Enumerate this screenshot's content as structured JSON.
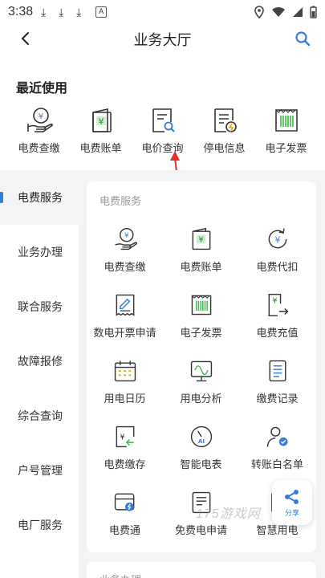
{
  "status_bar": {
    "time": "3:38"
  },
  "header": {
    "title": "业务大厅"
  },
  "recent": {
    "title": "最近使用",
    "items": [
      {
        "label": "电费查缴",
        "icon": "bill-pay-icon"
      },
      {
        "label": "电费账单",
        "icon": "wallet-icon"
      },
      {
        "label": "电价查询",
        "icon": "price-query-icon"
      },
      {
        "label": "停电信息",
        "icon": "outage-info-icon"
      },
      {
        "label": "电子发票",
        "icon": "e-invoice-icon"
      }
    ]
  },
  "sidebar": {
    "items": [
      {
        "label": "电费服务",
        "active": true
      },
      {
        "label": "业务办理"
      },
      {
        "label": "联合服务"
      },
      {
        "label": "故障报修"
      },
      {
        "label": "综合查询"
      },
      {
        "label": "户号管理"
      },
      {
        "label": "电厂服务"
      }
    ]
  },
  "section": {
    "title": "电费服务",
    "items": [
      {
        "label": "电费查缴",
        "icon": "bill-pay-icon"
      },
      {
        "label": "电费账单",
        "icon": "wallet-icon"
      },
      {
        "label": "电费代扣",
        "icon": "auto-debit-icon"
      },
      {
        "label": "数电开票申请",
        "icon": "invoice-apply-icon"
      },
      {
        "label": "电子发票",
        "icon": "e-invoice-icon"
      },
      {
        "label": "电费充值",
        "icon": "recharge-icon"
      },
      {
        "label": "用电日历",
        "icon": "calendar-icon"
      },
      {
        "label": "用电分析",
        "icon": "analysis-icon"
      },
      {
        "label": "缴费记录",
        "icon": "records-icon"
      },
      {
        "label": "电费缴存",
        "icon": "deposit-icon"
      },
      {
        "label": "智能电表",
        "icon": "smart-meter-icon"
      },
      {
        "label": "转账白名单",
        "icon": "whitelist-icon"
      },
      {
        "label": "电费通",
        "icon": "bill-card-icon"
      },
      {
        "label": "免费电申请",
        "icon": "free-electricity-icon"
      },
      {
        "label": "智慧用电",
        "icon": "smart-usage-icon"
      }
    ]
  },
  "next_section": {
    "title": "业务办理"
  },
  "share": {
    "label": "分享"
  },
  "watermark": {
    "text": "175游戏网"
  },
  "colors": {
    "accent": "#3a7bd5",
    "icon_stroke": "#333333",
    "icon_accent": "#3a7bd5",
    "yellow_accent": "#e8a400",
    "green_accent": "#3fb64a"
  }
}
